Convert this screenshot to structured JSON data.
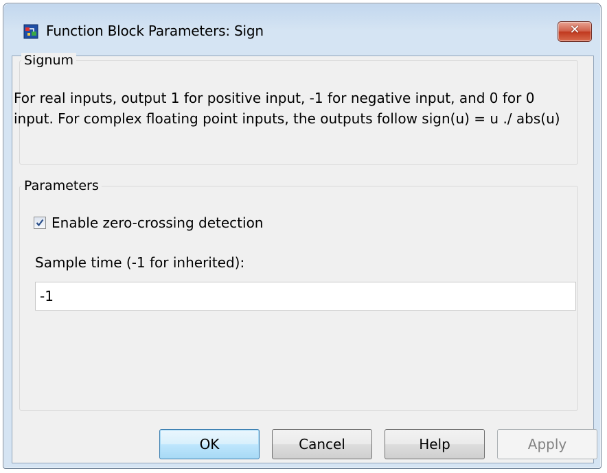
{
  "window": {
    "title": "Function Block Parameters: Sign",
    "close_symbol": "✕"
  },
  "signum": {
    "group_title": "Signum",
    "description": "For real inputs, output 1 for positive input, -1 for negative input, and 0 for 0 input.  For complex floating point inputs, the outputs follow sign(u) = u ./ abs(u)"
  },
  "parameters": {
    "group_title": "Parameters",
    "zero_crossing": {
      "label": "Enable zero-crossing detection",
      "checked": true
    },
    "sample_time": {
      "label": "Sample time (-1 for inherited):",
      "value": "-1"
    }
  },
  "buttons": {
    "ok": "OK",
    "cancel": "Cancel",
    "help": "Help",
    "apply": "Apply"
  },
  "colors": {
    "accent": "#3c7fb1",
    "close": "#c0391f"
  }
}
